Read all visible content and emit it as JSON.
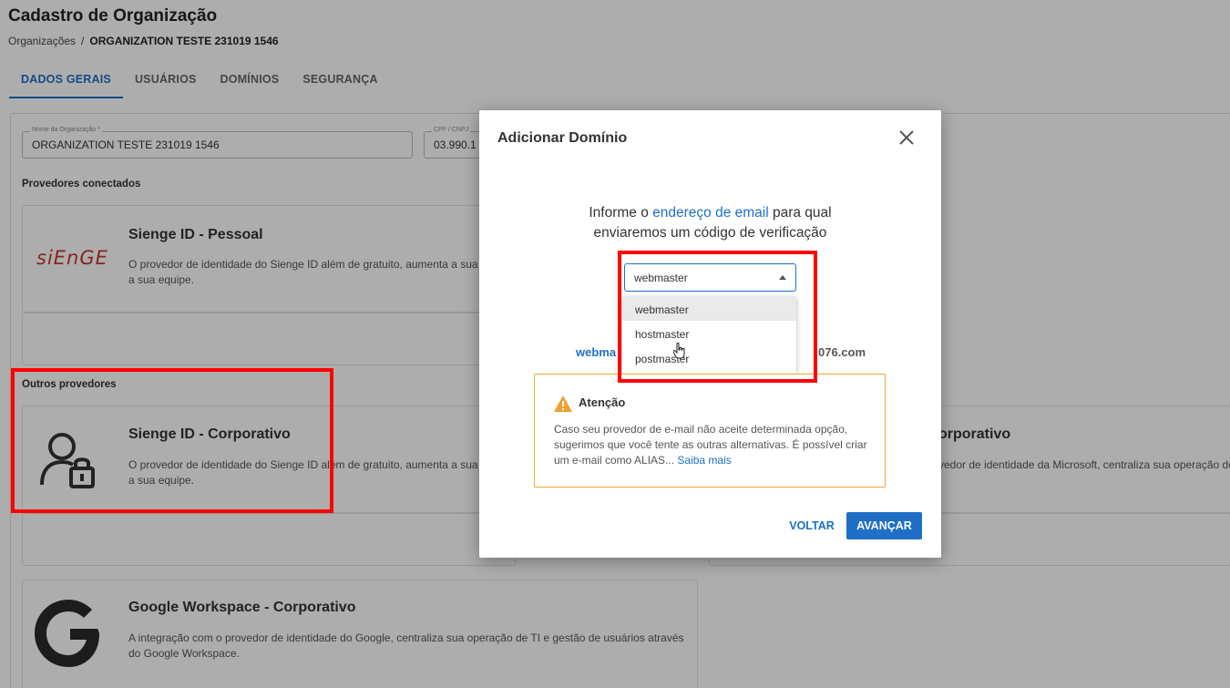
{
  "page": {
    "title": "Cadastro de Organização",
    "breadcrumb": {
      "root": "Organizações",
      "separator": "/",
      "current": "ORGANIZATION TESTE 231019 1546"
    },
    "tabs": [
      "DADOS GERAIS",
      "USUÁRIOS",
      "DOMÍNIOS",
      "SEGURANÇA"
    ],
    "fields": {
      "org_name": {
        "label": "Nome da Organização *",
        "value": "ORGANIZATION TESTE 231019 1546"
      },
      "cpf_cnpj": {
        "label": "CPF / CNPJ",
        "value": "03.990.1"
      }
    },
    "sections": {
      "connected": "Provedores conectados",
      "others": "Outros provedores"
    },
    "cards": {
      "sienge_pessoal": {
        "logo": "siEnGE",
        "title": "Sienge ID - Pessoal",
        "desc1": "O provedor de identidade do Sienge ID além de gratuito, aumenta a sua s",
        "desc2": "a sua equipe."
      },
      "sienge_corporativo": {
        "title": "Sienge ID - Corporativo",
        "desc1": "O provedor de identidade do Sienge ID além de gratuito, aumenta a sua s",
        "desc2": "a sua equipe."
      },
      "microsoft": {
        "title": "orporativo",
        "desc": "vedor de identidade da Microsoft, centraliza sua operação de"
      },
      "google": {
        "title": "Google Workspace - Corporativo",
        "desc1": "A integração com o provedor de identidade do Google, centraliza sua operação de TI e gestão de usuários através",
        "desc2": "do Google Workspace."
      }
    }
  },
  "dialog": {
    "title": "Adicionar Domínio",
    "prompt": {
      "before": "Informe o ",
      "link": "endereço de email",
      "after": " para qual",
      "line2": "enviaremos um código de verificação"
    },
    "select": {
      "value": "webmaster",
      "options": [
        "webmaster",
        "hostmaster",
        "postmaster"
      ]
    },
    "email_preview": {
      "head": "webma",
      "tail": "076.com"
    },
    "warning": {
      "title": "Atenção",
      "text": "Caso seu provedor de e-mail não aceite determinada opção, sugerimos que você tente as outras alternativas. É possível criar um e-mail como ALIAS... ",
      "link": "Saiba mais"
    },
    "buttons": {
      "back": "VOLTAR",
      "next": "AVANÇAR"
    }
  },
  "colors": {
    "accent": "#1f6fc6",
    "warning": "#f0a830",
    "highlight": "#ff0000",
    "sienge_red": "#c7362d"
  }
}
